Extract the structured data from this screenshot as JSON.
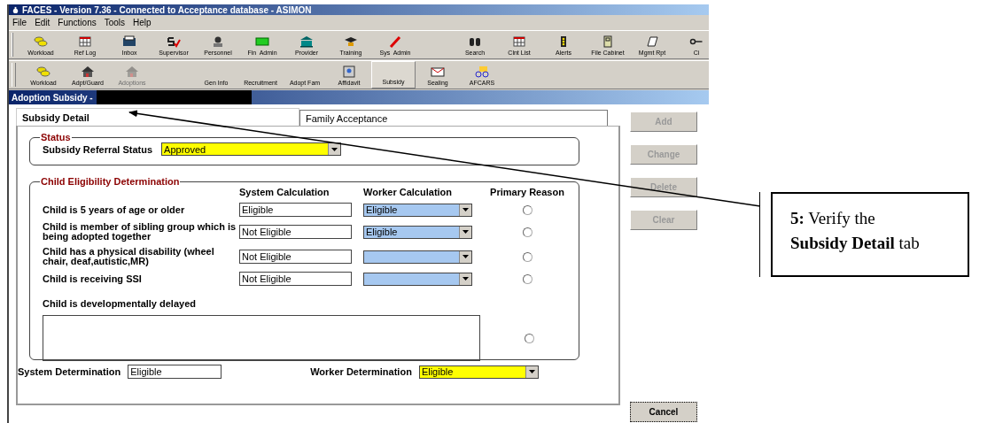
{
  "window": {
    "title": "FACES - Version 7.36 - Connected to Acceptance database - ASIMON"
  },
  "menu": [
    "File",
    "Edit",
    "Functions",
    "Tools",
    "Help"
  ],
  "toolbars": [
    {
      "groups": [
        [
          {
            "label": "Workload",
            "kind": "icon",
            "disabled": false,
            "selected": false
          },
          {
            "label": "Ref Log",
            "kind": "icon",
            "disabled": false,
            "selected": false
          },
          {
            "label": "Inbox",
            "kind": "icon",
            "disabled": false,
            "selected": false
          },
          {
            "label": "Supervisor",
            "kind": "icon",
            "disabled": false,
            "selected": false
          },
          {
            "label": "Personnel",
            "kind": "icon",
            "disabled": false,
            "selected": false
          },
          {
            "label": "Fin  Admin",
            "kind": "icon",
            "disabled": false,
            "selected": false
          },
          {
            "label": "Provider",
            "kind": "icon",
            "disabled": false,
            "selected": false
          },
          {
            "label": "Training",
            "kind": "icon",
            "disabled": false,
            "selected": false
          },
          {
            "label": "Sys  Admin",
            "kind": "icon",
            "disabled": false,
            "selected": false
          }
        ],
        [
          {
            "label": "Search",
            "kind": "icon",
            "disabled": false,
            "selected": false
          },
          {
            "label": "Clnt List",
            "kind": "icon",
            "disabled": false,
            "selected": false
          },
          {
            "label": "Alerts",
            "kind": "icon",
            "disabled": false,
            "selected": false
          },
          {
            "label": "File Cabinet",
            "kind": "icon",
            "disabled": false,
            "selected": false
          },
          {
            "label": "Mgmt Rpt",
            "kind": "icon",
            "disabled": false,
            "selected": false
          },
          {
            "label": "Ci",
            "kind": "icon",
            "disabled": false,
            "selected": false
          }
        ]
      ]
    },
    {
      "groups": [
        [
          {
            "label": "Workload",
            "kind": "icon",
            "disabled": false,
            "selected": false
          },
          {
            "label": "Adpt/Guard",
            "kind": "icon",
            "disabled": false,
            "selected": false
          },
          {
            "label": "Adoptions",
            "kind": "icon",
            "disabled": true,
            "selected": false
          }
        ],
        [
          {
            "label": "Gen Info",
            "kind": "plain",
            "disabled": false,
            "selected": false
          },
          {
            "label": "Recruitment",
            "kind": "plain",
            "disabled": false,
            "selected": false
          },
          {
            "label": "Adopt Fam",
            "kind": "plain",
            "disabled": false,
            "selected": false
          },
          {
            "label": "Affidavit",
            "kind": "icon",
            "disabled": false,
            "selected": false
          },
          {
            "label": "Subsidy",
            "kind": "plain",
            "disabled": false,
            "selected": true
          },
          {
            "label": "Sealing",
            "kind": "icon",
            "disabled": false,
            "selected": false
          },
          {
            "label": "AFCARS",
            "kind": "icon",
            "disabled": false,
            "selected": false
          }
        ]
      ]
    }
  ],
  "subwindow": {
    "title": "Adoption Subsidy -"
  },
  "tabs": [
    {
      "label": "Subsidy Detail",
      "selected": true
    },
    {
      "label": "Family Acceptance",
      "selected": false
    }
  ],
  "status_group": {
    "title": "Status",
    "label": "Subsidy Referral Status",
    "value": "Approved"
  },
  "eligibility_group": {
    "title": "Child Eligibility Determination",
    "columns": [
      "System Calculation",
      "Worker Calculation",
      "Primary Reason"
    ],
    "rows": [
      {
        "label": "Child is 5 years of age or older",
        "system": "Eligible",
        "worker": "Eligible",
        "selected": false
      },
      {
        "label": "Child is member of sibling group which is being adopted together",
        "system": "Not Eligible",
        "worker": "Eligible",
        "selected": false
      },
      {
        "label": "Child has a physical disability (wheel chair, deaf,autistic,MR)",
        "system": "Not Eligible",
        "selected": false
      },
      {
        "label": "Child is receiving SSI",
        "system": "Not Eligible",
        "selected": false
      }
    ],
    "delayed": {
      "label": "Child is developmentally delayed",
      "selected": false
    }
  },
  "system_determination": {
    "label": "System Determination",
    "value": "Eligible"
  },
  "worker_determination": {
    "label": "Worker Determination",
    "value": "Eligible"
  },
  "buttons": [
    {
      "label": "Add",
      "disabled": true
    },
    {
      "label": "Change",
      "disabled": true
    },
    {
      "label": "Delete",
      "disabled": true
    },
    {
      "label": "Clear",
      "disabled": true
    }
  ],
  "cancel": {
    "label": "Cancel",
    "disabled": false
  },
  "callout": {
    "text": "**5:** Verify the **Subsidy Detail** tab"
  }
}
